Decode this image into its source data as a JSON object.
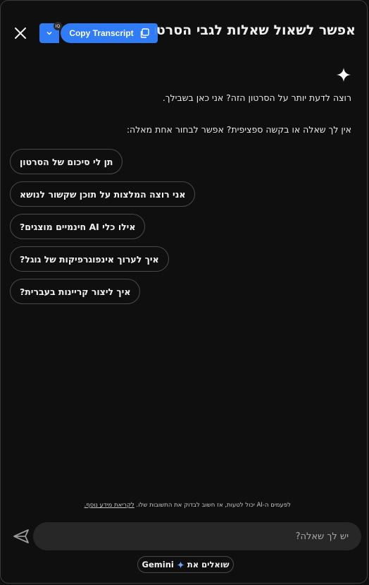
{
  "header": {
    "title": "אפשר לשאול שאלות לגבי הסרטו...",
    "close_icon": "close-icon",
    "extension": {
      "copy_label": "Copy Transcript",
      "badge": "IQ"
    }
  },
  "intro": {
    "line1": "רוצה לדעת יותר על הסרטון הזה? אני כאן בשבילך.",
    "line2": "אין לך שאלה או בקשה ספציפית? אפשר לבחור אחת מאלה:"
  },
  "suggestions": [
    "תן לי סיכום של הסרטון",
    "אני רוצה המלצות על תוכן שקשור לנושא",
    "אילו כלי AI חינמיים מוצגים?",
    "איך לערוך אינפוגרפיקות של גוגל?",
    "איך ליצור קריינות בעברית?"
  ],
  "disclaimer": {
    "text": "לפעמים ה-AI יכול לטעות, אז חשוב לבדוק את התשובות שלו. ",
    "link": "לקריאת מידע נוסף."
  },
  "composer": {
    "placeholder": "יש לך שאלה?"
  },
  "powered_by": {
    "label": "שואלים את",
    "brand": "Gemini"
  },
  "colors": {
    "accent": "#2f7cf6",
    "background": "#0f0f0f",
    "input_bg": "#272727"
  }
}
